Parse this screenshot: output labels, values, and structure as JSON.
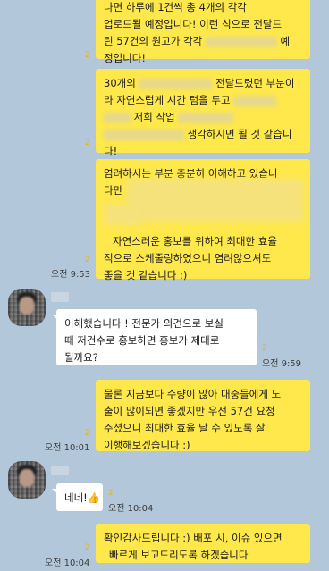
{
  "chat": {
    "messages": [
      {
        "lines": [
          "나면 하루에 1건씩 총 4개의 각각",
          "업로드될 예정입니다! 이런 식으로 전달드",
          "린 57건의 원고가 각각",
          "정입니다!"
        ],
        "unread": "2"
      },
      {
        "lines": [
          "30개의",
          "전달드렸던 부분이",
          "라 자연스럽게 시간 텀을 두고",
          "저희 작업",
          "생각하시면 될 것 같습니",
          "다!"
        ],
        "unread": "2"
      },
      {
        "lines": [
          "염려하시는 부분 충분히 이해하고 있습니",
          "다만",
          "자연스러운 홍보를 위하여 최대한 효율",
          "적으로 스케줄링하였으니 염려않으셔도",
          "좋을 것 같습니다 :)"
        ],
        "unread": "2",
        "time": "오전 9:53"
      },
      {
        "lines": [
          "이해했습니다 ! 전문가 의견으로 보실",
          "때 저건수로 홍보하면 홍보가 제대로",
          "될까요?"
        ],
        "unread": "2",
        "time": "오전 9:59"
      },
      {
        "lines": [
          "물론 지금보다 수량이 많아 대중들에게 노",
          "출이 많이되면 좋겠지만 우선 57건 요청",
          "주셨으니 최대한 효율 날 수 있도록 잘",
          "이행해보겠습니다 :)"
        ],
        "unread": "2",
        "time": "오전 10:01"
      },
      {
        "lines": [
          "네네!👍"
        ],
        "unread": "2",
        "time": "오전 10:04"
      },
      {
        "lines": [
          "확인감사드립니다 :) 배포 시, 이슈 있으면",
          "빠르게 보고드리도록 하겠습니다"
        ],
        "unread": "2",
        "time": "오전 10:04"
      }
    ]
  },
  "colors": {
    "background": "#b2c7d9",
    "my_bubble": "#fee84c",
    "their_bubble": "#ffffff",
    "unread": "#d8b920"
  },
  "icons": [
    "avatar",
    "thumbs-up-icon"
  ]
}
